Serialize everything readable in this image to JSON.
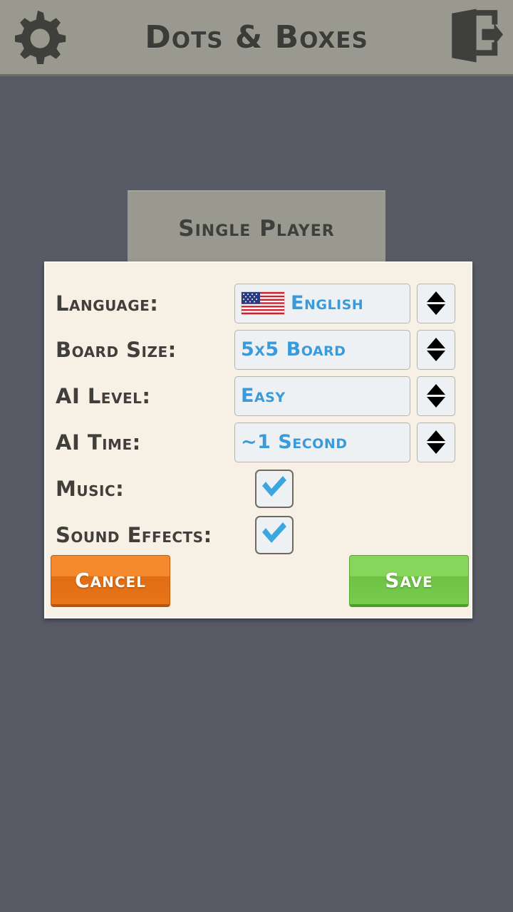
{
  "header": {
    "title": "Dots & Boxes",
    "gear_icon": "gear-icon",
    "exit_icon": "exit-door-icon"
  },
  "background": {
    "single_player_label": "Single Player"
  },
  "dialog": {
    "rows": [
      {
        "label": "Language:",
        "value": "English",
        "control": "selector",
        "flag": "us-flag-icon"
      },
      {
        "label": "Board Size:",
        "value": "5x5 Board",
        "control": "selector"
      },
      {
        "label": "AI Level:",
        "value": "Easy",
        "control": "selector"
      },
      {
        "label": "AI Time:",
        "value": "~1 Second",
        "control": "selector"
      },
      {
        "label": "Music:",
        "value": "checked",
        "control": "checkbox"
      },
      {
        "label": "Sound Effects:",
        "value": "checked",
        "control": "checkbox"
      }
    ],
    "cancel_label": "Cancel",
    "save_label": "Save"
  },
  "colors": {
    "page_background": "#585a66",
    "header_background": "#9a998f",
    "dialog_background": "#f6f1e4",
    "accent_blue": "#3b9ad9",
    "cancel_orange": "#f5892e",
    "save_green": "#86d65c",
    "label_dark": "#413f3b"
  }
}
